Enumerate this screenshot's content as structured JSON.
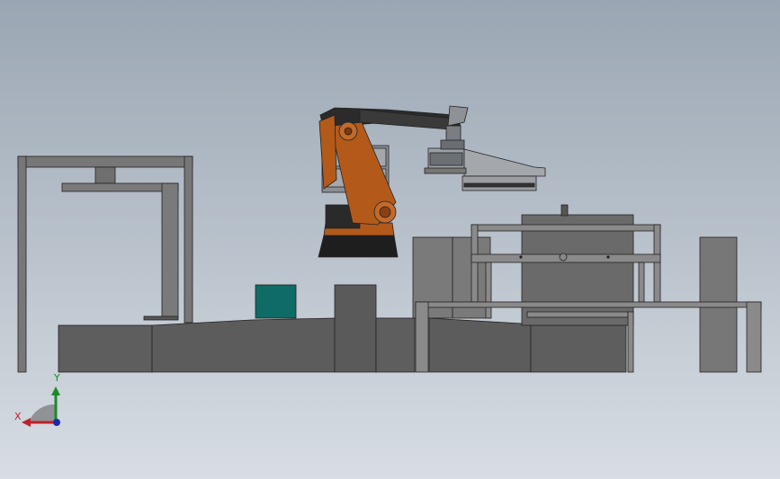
{
  "triad": {
    "y_label": "Y",
    "x_label": "X",
    "y_color": "#1a8a2a",
    "x_color": "#c0202a",
    "z_color": "#1a2aa8"
  },
  "colors": {
    "background_top": "#9aa6b3",
    "background_bottom": "#d7dde3",
    "frame_gray": "#6a6a6a",
    "dark_gray": "#585858",
    "robot_orange": "#b35a1a",
    "teal_box": "#0f6b66",
    "outline": "#222222"
  }
}
